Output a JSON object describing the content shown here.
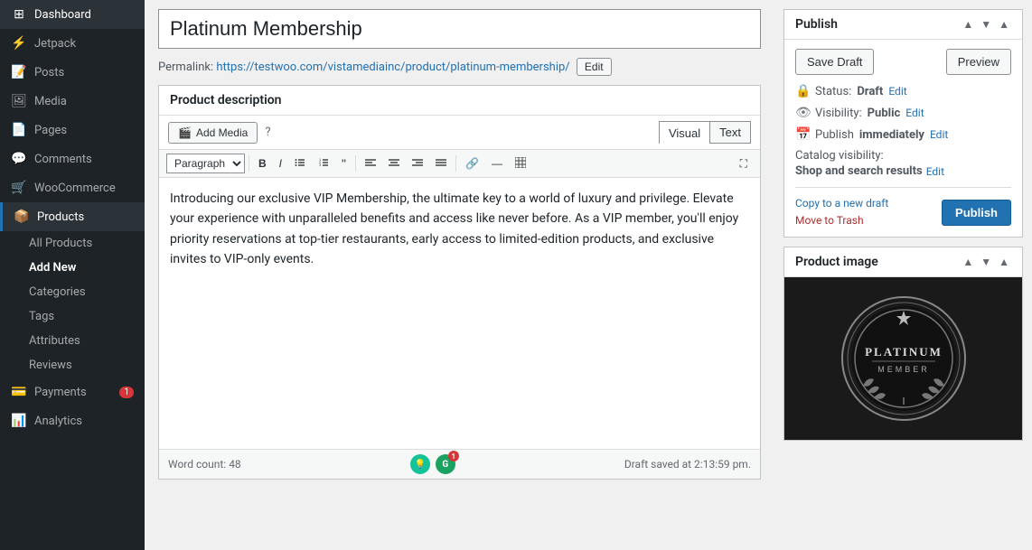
{
  "sidebar": {
    "items": [
      {
        "id": "dashboard",
        "label": "Dashboard",
        "icon": "⊞"
      },
      {
        "id": "jetpack",
        "label": "Jetpack",
        "icon": "⚡"
      },
      {
        "id": "posts",
        "label": "Posts",
        "icon": "📝"
      },
      {
        "id": "media",
        "label": "Media",
        "icon": "🖼"
      },
      {
        "id": "pages",
        "label": "Pages",
        "icon": "📄"
      },
      {
        "id": "comments",
        "label": "Comments",
        "icon": "💬"
      },
      {
        "id": "woocommerce",
        "label": "WooCommerce",
        "icon": "🛒"
      },
      {
        "id": "products",
        "label": "Products",
        "icon": "📦"
      },
      {
        "id": "payments",
        "label": "Payments",
        "icon": "💳",
        "badge": "1"
      },
      {
        "id": "analytics",
        "label": "Analytics",
        "icon": "📊"
      }
    ],
    "products_subitems": [
      {
        "id": "all-products",
        "label": "All Products"
      },
      {
        "id": "add-new",
        "label": "Add New",
        "active": true
      },
      {
        "id": "categories",
        "label": "Categories"
      },
      {
        "id": "tags",
        "label": "Tags"
      },
      {
        "id": "attributes",
        "label": "Attributes"
      },
      {
        "id": "reviews",
        "label": "Reviews"
      }
    ]
  },
  "product": {
    "title": "Platinum Membership",
    "permalink_base": "Permalink: ",
    "permalink_url": "https://testwoo.com/vistamediainc/product/platinum-membership/",
    "permalink_edit_label": "Edit",
    "description_label": "Product description",
    "add_media_label": "Add Media",
    "visual_tab": "Visual",
    "text_tab": "Text",
    "paragraph_option": "Paragraph",
    "body_text": "Introducing our exclusive VIP Membership, the ultimate key to a world of luxury and privilege. Elevate your experience with unparalleled benefits and access like never before. As a VIP member, you'll enjoy priority reservations at top-tier restaurants, early access to limited-edition products, and exclusive invites to VIP-only events.",
    "word_count_label": "Word count: ",
    "word_count": "48",
    "draft_saved": "Draft saved at 2:13:59 pm."
  },
  "publish": {
    "title": "Publish",
    "save_draft": "Save Draft",
    "preview": "Preview",
    "status_label": "Status: ",
    "status_value": "Draft",
    "status_edit": "Edit",
    "visibility_label": "Visibility: ",
    "visibility_value": "Public",
    "visibility_edit": "Edit",
    "publish_label": "Publish ",
    "publish_time": "immediately",
    "publish_edit": "Edit",
    "catalog_label": "Catalog visibility: ",
    "catalog_value": "Shop and search results",
    "catalog_edit": "Edit",
    "copy_draft": "Copy to a new draft",
    "move_trash": "Move to Trash",
    "publish_btn": "Publish"
  },
  "product_image": {
    "title": "Product image"
  },
  "format_toolbar": {
    "bold": "B",
    "italic": "I",
    "ul": "≡",
    "ol": "≡",
    "blockquote": "❝",
    "align_left": "≡",
    "align_center": "≡",
    "align_right": "≡",
    "align_justify": "≡",
    "link": "🔗",
    "more": "—",
    "table": "⊞",
    "fullscreen": "⛶"
  }
}
